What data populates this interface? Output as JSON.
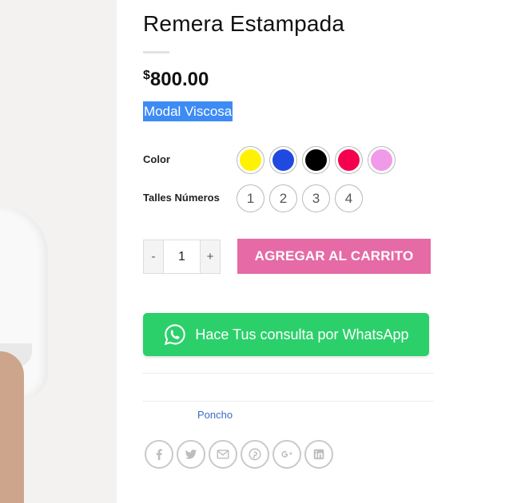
{
  "product": {
    "title": "Remera Estampada",
    "price_currency": "$",
    "price_amount": "800.00",
    "material": "Modal Viscosa"
  },
  "attributes": {
    "color_label": "Color",
    "colors": [
      {
        "name": "yellow",
        "hex": "#fff200"
      },
      {
        "name": "blue",
        "hex": "#2049e0"
      },
      {
        "name": "black",
        "hex": "#000000"
      },
      {
        "name": "red",
        "hex": "#f5004f"
      },
      {
        "name": "pink",
        "hex": "#f09ae9"
      }
    ],
    "size_label": "Talles Números",
    "sizes": [
      "1",
      "2",
      "3",
      "4"
    ]
  },
  "cart": {
    "minus": "-",
    "quantity": "1",
    "plus": "+",
    "add_label": "AGREGAR AL CARRITO"
  },
  "whatsapp": {
    "label": "Hace Tus consulta por WhatsApp"
  },
  "meta": {
    "brand": "Poncho"
  },
  "share": [
    "facebook-icon",
    "twitter-icon",
    "email-icon",
    "pinterest-icon",
    "google-plus-icon",
    "linkedin-icon"
  ],
  "theme": {
    "accent_cart": "#e56aa5",
    "accent_whatsapp": "#2bd06a",
    "selection": "#3d8bf5"
  }
}
